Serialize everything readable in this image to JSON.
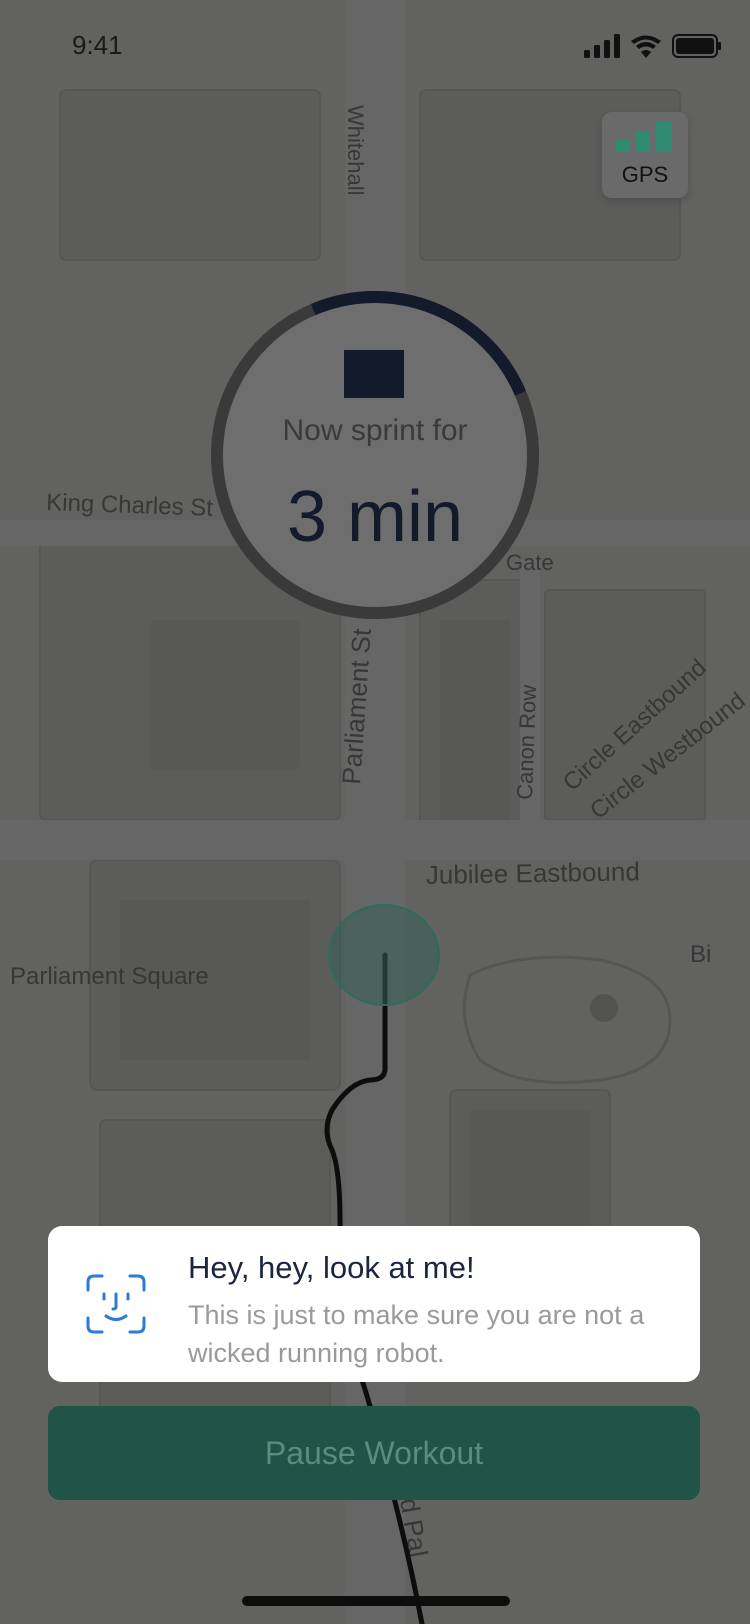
{
  "status_bar": {
    "time": "9:41",
    "icons": [
      "cellular-signal-icon",
      "wifi-icon",
      "battery-icon"
    ]
  },
  "gps": {
    "label": "GPS",
    "signal_bars_active": 3,
    "signal_color": "#2e8b6f"
  },
  "map": {
    "streets": [
      "Whitehall",
      "King Charles St",
      "Parliament St",
      "Canon Row",
      "Circle Eastbound",
      "Circle Westbound",
      "Jubilee Eastbound",
      "Parliament Square",
      "Gate",
      "Bi",
      "d Pal"
    ]
  },
  "timer": {
    "label": "Now sprint for",
    "value": "3 min",
    "progress": 0.25,
    "stop_icon": "stop-icon"
  },
  "toast": {
    "icon": "face-id-icon",
    "title": "Hey, hey, look at me!",
    "body": "This is just to make sure you are not a wicked running robot."
  },
  "actions": {
    "pause_label": "Pause Workout"
  },
  "colors": {
    "accent": "#2e8b6f",
    "navy": "#121a2b",
    "face_id_blue": "#2a7ad6"
  }
}
